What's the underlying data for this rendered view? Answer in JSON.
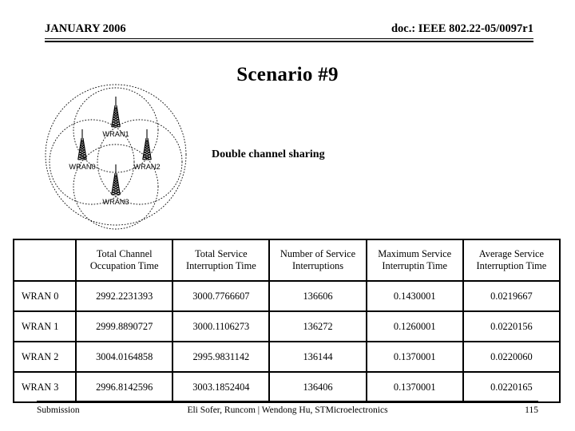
{
  "header": {
    "left": "JANUARY 2006",
    "right": "doc.: IEEE 802.22-05/0097r1"
  },
  "title": "Scenario #9",
  "caption": "Double channel sharing",
  "diagram": {
    "name": "wran-coverage-diagram",
    "nodes": [
      {
        "id": "wran0",
        "label": "WRAN0"
      },
      {
        "id": "wran1",
        "label": "WRAN1"
      },
      {
        "id": "wran2",
        "label": "WRAN2"
      },
      {
        "id": "wran3",
        "label": "WRAN3"
      }
    ]
  },
  "table": {
    "columns": [
      "",
      "Total Channel Occupation Time",
      "Total Service Interruption Time",
      "Number of Service Interruptions",
      "Maximum Service Interruptin Time",
      "Average Service Interruption Time"
    ],
    "columns_lines": [
      [
        "",
        ""
      ],
      [
        "Total Channel",
        "Occupation Time"
      ],
      [
        "Total Service",
        "Interruption Time"
      ],
      [
        "Number of Service",
        "Interruptions"
      ],
      [
        "Maximum Service",
        "Interruptin Time"
      ],
      [
        "Average Service",
        "Interruption Time"
      ]
    ],
    "rows": [
      {
        "label": "WRAN 0",
        "total_channel_occupation_time": "2992.2231393",
        "total_service_interruption_time": "3000.7766607",
        "number_of_service_interruptions": "136606",
        "maximum_service_interruption_time": "0.1430001",
        "average_service_interruption_time": "0.0219667"
      },
      {
        "label": "WRAN 1",
        "total_channel_occupation_time": "2999.8890727",
        "total_service_interruption_time": "3000.1106273",
        "number_of_service_interruptions": "136272",
        "maximum_service_interruption_time": "0.1260001",
        "average_service_interruption_time": "0.0220156"
      },
      {
        "label": "WRAN 2",
        "total_channel_occupation_time": "3004.0164858",
        "total_service_interruption_time": "2995.9831142",
        "number_of_service_interruptions": "136144",
        "maximum_service_interruption_time": "0.1370001",
        "average_service_interruption_time": "0.0220060"
      },
      {
        "label": "WRAN 3",
        "total_channel_occupation_time": "2996.8142596",
        "total_service_interruption_time": "3003.1852404",
        "number_of_service_interruptions": "136406",
        "maximum_service_interruption_time": "0.1370001",
        "average_service_interruption_time": "0.0220165"
      }
    ]
  },
  "footer": {
    "left": "Submission",
    "center": "Eli Sofer, Runcom  |  Wendong Hu, STMicroelectronics",
    "right": "115"
  }
}
